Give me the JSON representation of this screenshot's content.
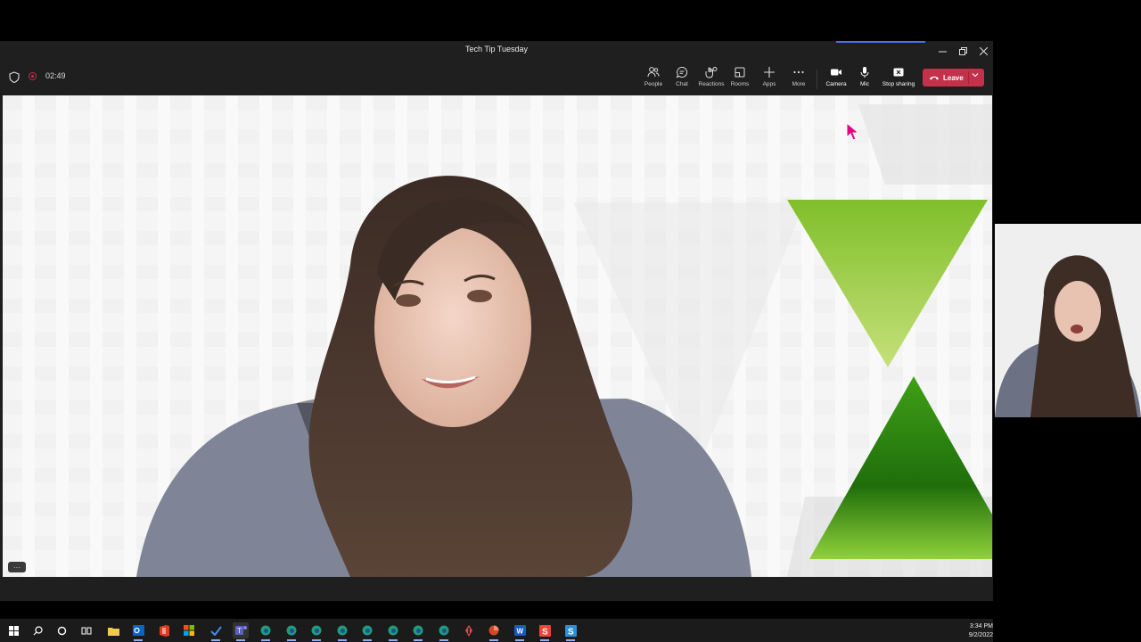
{
  "window": {
    "title": "Tech Tip Tuesday",
    "controls": [
      "minimize",
      "restore",
      "close"
    ]
  },
  "meeting": {
    "timer": "02:49",
    "toolbar": [
      {
        "id": "people",
        "label": "People",
        "icon": "people-icon"
      },
      {
        "id": "chat",
        "label": "Chat",
        "icon": "chat-icon"
      },
      {
        "id": "reactions",
        "label": "Reactions",
        "icon": "reactions-icon"
      },
      {
        "id": "rooms",
        "label": "Rooms",
        "icon": "rooms-icon"
      },
      {
        "id": "apps",
        "label": "Apps",
        "icon": "plus-icon"
      },
      {
        "id": "more",
        "label": "More",
        "icon": "ellipsis-icon"
      },
      {
        "id": "camera",
        "label": "Camera",
        "icon": "camera-icon"
      },
      {
        "id": "mic",
        "label": "Mic",
        "icon": "mic-icon"
      },
      {
        "id": "share",
        "label": "Stop sharing",
        "icon": "stop-share-icon"
      }
    ],
    "leave_label": "Leave",
    "more_pill": "···"
  },
  "taskbar": {
    "time": "3:34 PM",
    "date": "9/2/2022",
    "apps": [
      "windows-start-icon",
      "search-icon",
      "cortana-icon",
      "task-view-icon",
      "file-explorer-icon",
      "outlook-icon",
      "office-icon",
      "store-icon",
      "todo-icon",
      "teams-icon",
      "edge-icon",
      "edge-icon",
      "edge-icon",
      "edge-icon",
      "edge-icon",
      "edge-icon",
      "edge-icon",
      "edge-icon",
      "app-icon",
      "powerpoint-icon",
      "word-icon",
      "snagit-icon",
      "snagit-editor-icon"
    ]
  },
  "colors": {
    "leave": "#c4314b",
    "toolbar": "#1f1f1f",
    "accent": "#4f6bed",
    "green_light": "#8dc63f",
    "green_dark": "#2e7d0f",
    "cursor": "#e6007e"
  }
}
